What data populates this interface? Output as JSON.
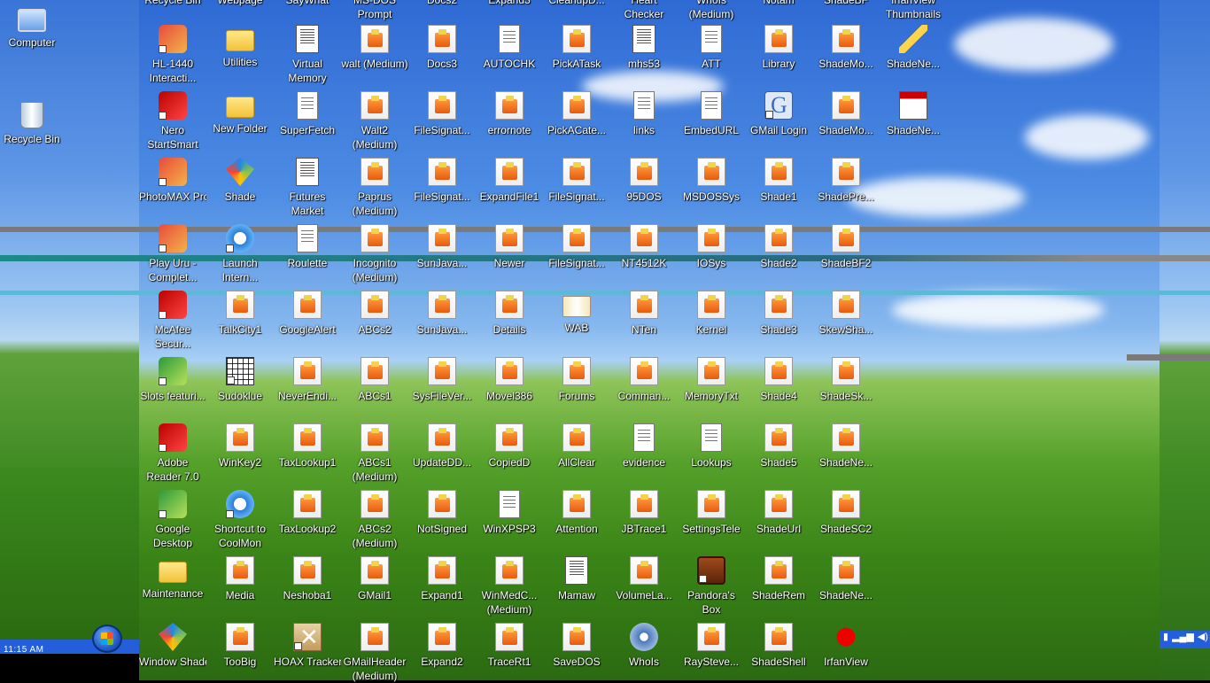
{
  "desktop": {
    "left_icons": [
      {
        "label": "Computer",
        "kind": "computer"
      },
      {
        "label": "Recycle Bin",
        "kind": "bin"
      }
    ],
    "top_clipped_labels": [
      "Recycle Bin",
      "Webpage",
      "SayWhat",
      "MS-DOS Prompt",
      "Docs2",
      "Expand3",
      "CleanupD...",
      "Heart Checker",
      "WhoIs (Medium)",
      "Notam",
      "ShadeBF",
      "IrfanView Thumbnails"
    ],
    "grid": [
      [
        {
          "label": "HL-1440 Interacti...",
          "kind": "app",
          "shortcut": true
        },
        {
          "label": "Utilities",
          "kind": "folder"
        },
        {
          "label": "Virtual Memory",
          "kind": "doc"
        },
        {
          "label": "walt (Medium)",
          "kind": "html"
        },
        {
          "label": "Docs3",
          "kind": "html"
        },
        {
          "label": "AUTOCHK",
          "kind": "txt"
        },
        {
          "label": "PickATask",
          "kind": "html"
        },
        {
          "label": "mhs53",
          "kind": "doc"
        },
        {
          "label": "ATT",
          "kind": "txt"
        },
        {
          "label": "Library",
          "kind": "html"
        },
        {
          "label": "ShadeMo...",
          "kind": "html"
        },
        {
          "label": "ShadeNe...",
          "kind": "pencil"
        }
      ],
      [
        {
          "label": "Nero StartSmart",
          "kind": "red",
          "shortcut": true
        },
        {
          "label": "New Folder",
          "kind": "folder"
        },
        {
          "label": "SuperFetch",
          "kind": "txt"
        },
        {
          "label": "Walt2 (Medium)",
          "kind": "html"
        },
        {
          "label": "FileSignat...",
          "kind": "html"
        },
        {
          "label": "errornote",
          "kind": "html"
        },
        {
          "label": "PickACate...",
          "kind": "html"
        },
        {
          "label": "links",
          "kind": "txt"
        },
        {
          "label": "EmbedURL",
          "kind": "txt"
        },
        {
          "label": "GMail Login",
          "kind": "g",
          "shortcut": true
        },
        {
          "label": "ShadeMo...",
          "kind": "html"
        },
        {
          "label": "ShadeNe...",
          "kind": "news"
        }
      ],
      [
        {
          "label": "PhotoMAX Pro",
          "kind": "app",
          "shortcut": true
        },
        {
          "label": "Shade",
          "kind": "shade"
        },
        {
          "label": "Futures Market",
          "kind": "doc"
        },
        {
          "label": "Paprus (Medium)",
          "kind": "html"
        },
        {
          "label": "FileSignat...",
          "kind": "html"
        },
        {
          "label": "ExpandFile1",
          "kind": "html"
        },
        {
          "label": "FileSignat...",
          "kind": "html"
        },
        {
          "label": "95DOS",
          "kind": "html"
        },
        {
          "label": "MSDOSSys",
          "kind": "html"
        },
        {
          "label": "Shade1",
          "kind": "html"
        },
        {
          "label": "ShadePre...",
          "kind": "html"
        },
        null
      ],
      [
        {
          "label": "Play Uru - Complet...",
          "kind": "app",
          "shortcut": true
        },
        {
          "label": "Launch Intern...",
          "kind": "ie",
          "shortcut": true
        },
        {
          "label": "Roulette",
          "kind": "txt"
        },
        {
          "label": "Incognito (Medium)",
          "kind": "html"
        },
        {
          "label": "SunJava...",
          "kind": "html"
        },
        {
          "label": "Newer",
          "kind": "html"
        },
        {
          "label": "FileSignat...",
          "kind": "html"
        },
        {
          "label": "NT4512K",
          "kind": "html"
        },
        {
          "label": "IOSys",
          "kind": "html"
        },
        {
          "label": "Shade2",
          "kind": "html"
        },
        {
          "label": "ShadeBF2",
          "kind": "html"
        },
        null
      ],
      [
        {
          "label": "McAfee Secur...",
          "kind": "red",
          "shortcut": true
        },
        {
          "label": "TalkCity1",
          "kind": "html"
        },
        {
          "label": "GoogleAlert",
          "kind": "html"
        },
        {
          "label": "ABCs2",
          "kind": "html"
        },
        {
          "label": "SunJava...",
          "kind": "html"
        },
        {
          "label": "Details",
          "kind": "html"
        },
        {
          "label": "WAB",
          "kind": "book"
        },
        {
          "label": "NTen",
          "kind": "html"
        },
        {
          "label": "Kernel",
          "kind": "html"
        },
        {
          "label": "Shade3",
          "kind": "html"
        },
        {
          "label": "SkewSha...",
          "kind": "html"
        },
        null
      ],
      [
        {
          "label": "Slots featuri...",
          "kind": "green",
          "shortcut": true
        },
        {
          "label": "Sudoklue",
          "kind": "grid",
          "shortcut": true
        },
        {
          "label": "NeverEndi...",
          "kind": "html"
        },
        {
          "label": "ABCs1",
          "kind": "html"
        },
        {
          "label": "SysFileVer...",
          "kind": "html"
        },
        {
          "label": "Movel386",
          "kind": "html"
        },
        {
          "label": "Forums",
          "kind": "html"
        },
        {
          "label": "Comman...",
          "kind": "html"
        },
        {
          "label": "MemoryTxt",
          "kind": "html"
        },
        {
          "label": "Shade4",
          "kind": "html"
        },
        {
          "label": "ShadeSk...",
          "kind": "html"
        },
        null
      ],
      [
        {
          "label": "Adobe Reader 7.0",
          "kind": "red",
          "shortcut": true
        },
        {
          "label": "WinKey2",
          "kind": "html"
        },
        {
          "label": "TaxLookup1",
          "kind": "html"
        },
        {
          "label": "ABCs1 (Medium)",
          "kind": "html"
        },
        {
          "label": "UpdateDD...",
          "kind": "html"
        },
        {
          "label": "CopiedD",
          "kind": "html"
        },
        {
          "label": "AllClear",
          "kind": "html"
        },
        {
          "label": "evidence",
          "kind": "txt"
        },
        {
          "label": "Lookups",
          "kind": "txt"
        },
        {
          "label": "Shade5",
          "kind": "html"
        },
        {
          "label": "ShadeNe...",
          "kind": "html"
        },
        null
      ],
      [
        {
          "label": "Google Desktop",
          "kind": "green",
          "shortcut": true
        },
        {
          "label": "Shortcut to CoolMon",
          "kind": "ie",
          "shortcut": true
        },
        {
          "label": "TaxLookup2",
          "kind": "html"
        },
        {
          "label": "ABCs2 (Medium)",
          "kind": "html"
        },
        {
          "label": "NotSigned",
          "kind": "html"
        },
        {
          "label": "WinXPSP3",
          "kind": "txt"
        },
        {
          "label": "Attention",
          "kind": "html"
        },
        {
          "label": "JBTrace1",
          "kind": "html"
        },
        {
          "label": "SettingsTele",
          "kind": "html"
        },
        {
          "label": "ShadeUrl",
          "kind": "html"
        },
        {
          "label": "ShadeSC2",
          "kind": "html"
        },
        null
      ],
      [
        {
          "label": "Maintenance",
          "kind": "folder"
        },
        {
          "label": "Media",
          "kind": "html"
        },
        {
          "label": "Neshoba1",
          "kind": "html"
        },
        {
          "label": "GMail1",
          "kind": "html"
        },
        {
          "label": "Expand1",
          "kind": "html"
        },
        {
          "label": "WinMedC... (Medium)",
          "kind": "html"
        },
        {
          "label": "Mamaw",
          "kind": "doc"
        },
        {
          "label": "VolumeLa...",
          "kind": "html"
        },
        {
          "label": "Pandora's Box",
          "kind": "chest",
          "shortcut": true
        },
        {
          "label": "ShadeRem",
          "kind": "html"
        },
        {
          "label": "ShadeNe...",
          "kind": "html"
        },
        null
      ],
      [
        {
          "label": "Window Shade",
          "kind": "shade"
        },
        {
          "label": "TooBig",
          "kind": "html"
        },
        {
          "label": "HOAX Tracker",
          "kind": "hoax",
          "shortcut": true
        },
        {
          "label": "GMailHeader (Medium)",
          "kind": "html"
        },
        {
          "label": "Expand2",
          "kind": "html"
        },
        {
          "label": "TraceRt1",
          "kind": "html"
        },
        {
          "label": "SaveDOS",
          "kind": "html"
        },
        {
          "label": "WhoIs",
          "kind": "gear"
        },
        {
          "label": "RaySteve...",
          "kind": "html"
        },
        {
          "label": "ShadeShell",
          "kind": "html"
        },
        {
          "label": "IrfanView",
          "kind": "splat"
        },
        null
      ]
    ]
  },
  "taskbar": {
    "clock": "11:15 AM",
    "start_icon": "windows-logo-icon"
  }
}
